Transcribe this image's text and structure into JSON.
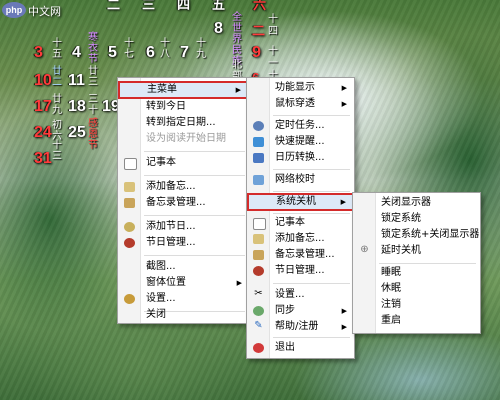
{
  "calendar": {
    "top_row": [
      "二",
      "三",
      "四",
      "五",
      "六"
    ],
    "rows": [
      {
        "day": "3",
        "red": true,
        "lunar": "十五"
      },
      {
        "day": "4",
        "red": false,
        "lunar": "寒衣节"
      },
      {
        "day": "5",
        "red": false,
        "lunar": "十七"
      },
      {
        "day": "6",
        "red": false,
        "lunar": "十八"
      },
      {
        "day": "7",
        "red": false,
        "lunar": "十九"
      },
      {
        "day": "8",
        "red": false,
        "lunar": "二十"
      },
      {
        "day": "9",
        "red": true,
        "lunar": "廿一"
      }
    ],
    "row2": [
      {
        "day": "10",
        "red": true,
        "lunar": "廿二"
      },
      {
        "day": "11",
        "red": false,
        "lunar": "廿三"
      }
    ],
    "row3": [
      {
        "day": "17",
        "red": true,
        "lunar": "廿九"
      },
      {
        "day": "18",
        "red": false,
        "lunar": "三十"
      },
      {
        "day": "19",
        "red": false,
        "lunar": "十月"
      }
    ],
    "row4": [
      {
        "day": "24",
        "red": true,
        "lunar": "初六"
      },
      {
        "day": "25",
        "red": false,
        "lunar": "感恩节"
      }
    ],
    "row5": [
      {
        "day": "31",
        "red": true,
        "lunar": "十三"
      }
    ],
    "right_col": [
      "十",
      "四",
      "十",
      "一",
      "十",
      "三"
    ],
    "right_top": "二",
    "side_event": "全世界民族",
    "side_event2": "北部湾"
  },
  "menu_main": {
    "items": [
      {
        "label": "主菜单",
        "arrow": true,
        "selected": true,
        "highlight": true
      },
      {
        "label": "转到今日"
      },
      {
        "label": "转到指定日期..."
      },
      {
        "label": "设为阅读开始日期",
        "disabled": true
      },
      {
        "label": "记事本",
        "icon": "notebook-icon"
      },
      {
        "label": "添加备忘...",
        "icon": "add-memo-icon"
      },
      {
        "label": "备忘录管理...",
        "icon": "memo-manage-icon"
      },
      {
        "label": "添加节日...",
        "icon": "add-festival-icon"
      },
      {
        "label": "节日管理...",
        "icon": "festival-manage-icon"
      },
      {
        "label": "截图..."
      },
      {
        "label": "窗体位置",
        "arrow": true
      },
      {
        "label": "设置...",
        "icon": "settings-icon"
      },
      {
        "label": "关闭"
      }
    ]
  },
  "menu_sub": {
    "items": [
      {
        "label": "功能显示",
        "arrow": true
      },
      {
        "label": "鼠标穿透",
        "arrow": true
      },
      {
        "label": "定时任务...",
        "icon": "timer-task-icon"
      },
      {
        "label": "快速提醒...",
        "icon": "quick-remind-icon"
      },
      {
        "label": "日历转换...",
        "icon": "calendar-convert-icon"
      },
      {
        "label": "网络校时",
        "icon": "network-time-icon"
      },
      {
        "label": "系统关机",
        "arrow": true,
        "selected": true,
        "highlight": true
      },
      {
        "label": "记事本",
        "icon": "notebook-icon"
      },
      {
        "label": "添加备忘...",
        "icon": "add-memo-icon"
      },
      {
        "label": "备忘录管理...",
        "icon": "memo-manage-icon"
      },
      {
        "label": "节日管理...",
        "icon": "festival-manage-icon"
      },
      {
        "label": "设置...",
        "icon": "settings-icon"
      },
      {
        "label": "同步",
        "arrow": true
      },
      {
        "label": "帮助/注册",
        "arrow": true
      },
      {
        "label": "退出",
        "icon": "exit-icon"
      }
    ]
  },
  "menu_shutdown": {
    "items": [
      {
        "label": "关闭显示器"
      },
      {
        "label": "锁定系统"
      },
      {
        "label": "锁定系统+关闭显示器"
      },
      {
        "label": "延时关机",
        "icon": "clock-icon"
      },
      {
        "label": "睡眠"
      },
      {
        "label": "休眠"
      },
      {
        "label": "注销"
      },
      {
        "label": "重启"
      }
    ]
  },
  "watermark": "php 中文网"
}
